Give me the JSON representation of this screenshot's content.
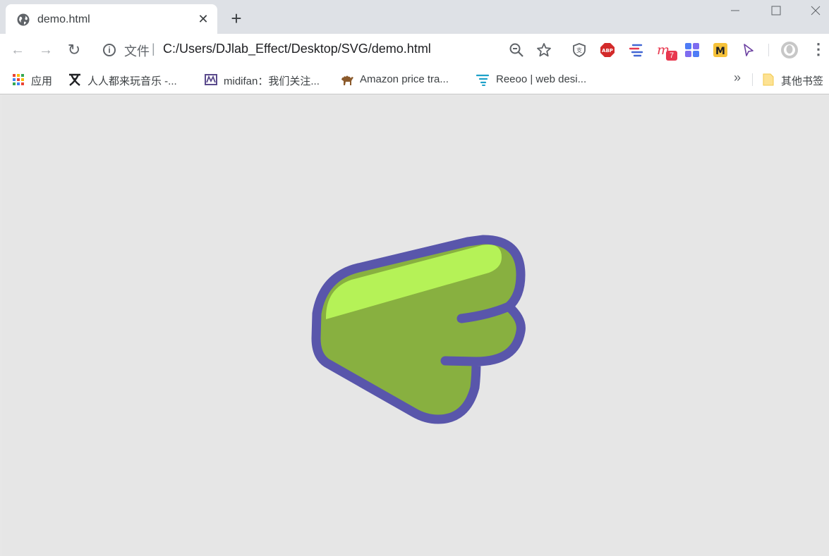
{
  "tab": {
    "title": "demo.html",
    "close_glyph": "✕",
    "favicon": "globe-icon"
  },
  "newtab": {
    "glyph": "+"
  },
  "window_controls": {
    "minimize": "—",
    "maximize": "☐",
    "close": "✕"
  },
  "toolbar": {
    "back_glyph": "←",
    "forward_glyph": "→",
    "reload_glyph": "↻",
    "info_glyph": "i",
    "scheme_label": "文件",
    "separator": "|",
    "url": "C:/Users/DJlab_Effect/Desktop/SVG/demo.html",
    "extension_badge": "7",
    "menu_glyph": "⋮"
  },
  "bookmarks": {
    "items": [
      {
        "label": "应用",
        "icon": "apps-grid-icon"
      },
      {
        "label": "人人都来玩音乐 -...",
        "icon": "yi-logo-icon"
      },
      {
        "label": "midifan：我们关注...",
        "icon": "midifan-logo-icon"
      },
      {
        "label": "Amazon price tra...",
        "icon": "camel-icon"
      },
      {
        "label": "Reeoo | web desi...",
        "icon": "reeoo-logo-icon"
      }
    ],
    "overflow_glyph": "»",
    "other_label": "其他书签"
  },
  "colors": {
    "shape_outline": "#5956ab",
    "shape_fill": "#88b040",
    "shape_highlight": "#b5f257",
    "page_background": "#e6e6e6"
  }
}
